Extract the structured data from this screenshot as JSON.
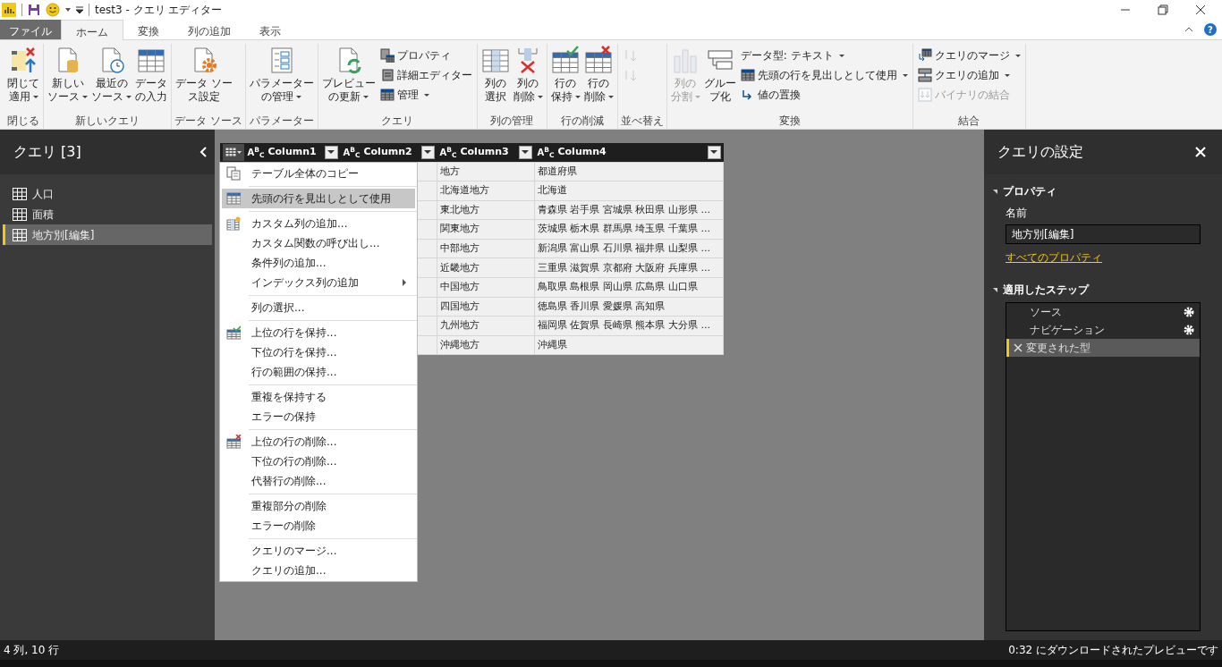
{
  "window": {
    "title": "test3 - クエリ エディター"
  },
  "ribbon_tabs": [
    {
      "label": "ファイル",
      "kind": "file",
      "selected": false
    },
    {
      "label": "ホーム",
      "kind": "tab",
      "selected": true
    },
    {
      "label": "変換",
      "kind": "tab",
      "selected": false
    },
    {
      "label": "列の追加",
      "kind": "tab",
      "selected": false
    },
    {
      "label": "表示",
      "kind": "tab",
      "selected": false
    }
  ],
  "help": "?",
  "ribbon_groups": [
    {
      "label": "閉じる",
      "large": [
        {
          "lines": [
            "閉じて",
            "適用"
          ],
          "kind": "apply",
          "dropdown": true,
          "disabled": false
        }
      ]
    },
    {
      "label": "新しいクエリ",
      "large": [
        {
          "lines": [
            "新しい",
            "ソース"
          ],
          "kind": "new",
          "dropdown": true,
          "disabled": false
        },
        {
          "lines": [
            "最近の",
            "ソース"
          ],
          "kind": "recent",
          "dropdown": true,
          "disabled": false
        },
        {
          "lines": [
            "データ",
            "の入力"
          ],
          "kind": "table",
          "dropdown": false,
          "disabled": false
        }
      ]
    },
    {
      "label": "データ ソース",
      "large": [
        {
          "lines": [
            "データ ソー",
            "ス設定"
          ],
          "kind": "dsettings",
          "dropdown": false,
          "disabled": false
        }
      ]
    },
    {
      "label": "パラメーター",
      "large": [
        {
          "lines": [
            "パラメーター",
            "の管理"
          ],
          "kind": "params",
          "dropdown": true,
          "disabled": false
        }
      ]
    },
    {
      "label": "クエリ",
      "large": [
        {
          "lines": [
            "プレビュー",
            "の更新"
          ],
          "kind": "refresh",
          "dropdown": true,
          "disabled": false
        }
      ],
      "small": [
        {
          "label": "プロパティ",
          "kind": "props",
          "dropdown": false,
          "disabled": false
        },
        {
          "label": "詳細エディター",
          "kind": "editor",
          "dropdown": false,
          "disabled": false
        },
        {
          "label": "管理",
          "kind": "grid",
          "dropdown": true,
          "disabled": false
        }
      ]
    },
    {
      "label": "列の管理",
      "large": [
        {
          "lines": [
            "列の",
            "選択"
          ],
          "kind": "choosecols",
          "dropdown": false,
          "disabled": false
        },
        {
          "lines": [
            "列の",
            "削除"
          ],
          "kind": "removecols",
          "dropdown": true,
          "disabled": false
        }
      ]
    },
    {
      "label": "行の削減",
      "large": [
        {
          "lines": [
            "行の",
            "保持"
          ],
          "kind": "keeprows",
          "dropdown": true,
          "disabled": false
        },
        {
          "lines": [
            "行の",
            "削除"
          ],
          "kind": "removerows",
          "dropdown": true,
          "disabled": false
        }
      ]
    },
    {
      "label": "並べ替え",
      "small": [
        {
          "kind": "sortasc",
          "dropdown": false,
          "disabled": true
        },
        {
          "kind": "sortdesc",
          "dropdown": false,
          "disabled": true
        }
      ]
    },
    {
      "label": "変換",
      "large": [
        {
          "lines": [
            "列の",
            "分割"
          ],
          "kind": "split",
          "dropdown": true,
          "disabled": true
        },
        {
          "lines": [
            "グルー",
            "プ化"
          ],
          "kind": "group",
          "dropdown": false,
          "disabled": false
        }
      ],
      "small": [
        {
          "label": "データ型: テキスト",
          "kind": "none",
          "dropdown": true,
          "disabled": false
        },
        {
          "label": "先頭の行を見出しとして使用",
          "kind": "grid",
          "dropdown": true,
          "disabled": false
        },
        {
          "label": "値の置換",
          "kind": "replace",
          "dropdown": false,
          "disabled": false
        }
      ]
    },
    {
      "label": "結合",
      "small": [
        {
          "label": "クエリのマージ",
          "kind": "merge",
          "dropdown": true,
          "disabled": false
        },
        {
          "label": "クエリの追加",
          "kind": "append",
          "dropdown": true,
          "disabled": false
        },
        {
          "label": "バイナリの結合",
          "kind": "binary",
          "dropdown": false,
          "disabled": true
        }
      ]
    }
  ],
  "queries_pane": {
    "title": "クエリ [3]",
    "items": [
      {
        "label": "人口",
        "selected": false
      },
      {
        "label": "面積",
        "selected": false
      },
      {
        "label": "地方別[編集]",
        "selected": true
      }
    ]
  },
  "table": {
    "columns": [
      {
        "type": "A$^{B}$$_{C}$",
        "name": "Column1"
      },
      {
        "type": "A$^{B}$$_{C}$",
        "name": "Column2"
      },
      {
        "type": "A$^{B}$$_{C}$",
        "name": "Column3"
      },
      {
        "type": "A$^{B}$$_{C}$",
        "name": "Column4"
      }
    ],
    "rows": [
      {
        "column3": "地方",
        "column4": "都道府県"
      },
      {
        "column3": "北海道地方",
        "column4": "北海道"
      },
      {
        "column3": "東北地方",
        "column4": "青森県 岩手県 宮城県 秋田県 山形県 ..."
      },
      {
        "column3": "関東地方",
        "column4": "茨城県 栃木県 群馬県 埼玉県 千葉県 ..."
      },
      {
        "column3": "中部地方",
        "column4": "新潟県 富山県 石川県 福井県 山梨県 ..."
      },
      {
        "column3": "近畿地方",
        "column4": "三重県 滋賀県 京都府 大阪府 兵庫県 ..."
      },
      {
        "column3": "中国地方",
        "column4": "鳥取県 島根県 岡山県 広島県 山口県"
      },
      {
        "column3": "四国地方",
        "column4": "徳島県 香川県 愛媛県 高知県"
      },
      {
        "column3": "九州地方",
        "column4": "福岡県 佐賀県 長崎県 熊本県 大分県 ..."
      },
      {
        "column3": "沖縄地方",
        "column4": "沖縄県"
      }
    ]
  },
  "table_menu": {
    "groups": [
      [
        {
          "label": "テーブル全体のコピー",
          "kind": "copy",
          "selected": false,
          "submenu": false
        }
      ],
      [
        {
          "label": "先頭の行を見出しとして使用",
          "kind": "header",
          "selected": true,
          "submenu": false
        }
      ],
      [
        {
          "label": "カスタム列の追加...",
          "kind": "custom",
          "selected": false,
          "submenu": false
        },
        {
          "label": "カスタム関数の呼び出し...",
          "kind": "plain",
          "selected": false,
          "submenu": false
        },
        {
          "label": "条件列の追加...",
          "kind": "plain",
          "selected": false,
          "submenu": false
        },
        {
          "label": "インデックス列の追加",
          "kind": "plain",
          "selected": false,
          "submenu": true
        }
      ],
      [
        {
          "label": "列の選択...",
          "kind": "plain",
          "selected": false,
          "submenu": false
        }
      ],
      [
        {
          "label": "上位の行を保持...",
          "kind": "keep",
          "selected": false,
          "submenu": false
        },
        {
          "label": "下位の行を保持...",
          "kind": "plain",
          "selected": false,
          "submenu": false
        },
        {
          "label": "行の範囲の保持...",
          "kind": "plain",
          "selected": false,
          "submenu": false
        }
      ],
      [
        {
          "label": "重複を保持する",
          "kind": "plain",
          "selected": false,
          "submenu": false
        },
        {
          "label": "エラーの保持",
          "kind": "plain",
          "selected": false,
          "submenu": false
        }
      ],
      [
        {
          "label": "上位の行の削除...",
          "kind": "remove",
          "selected": false,
          "submenu": false
        },
        {
          "label": "下位の行の削除...",
          "kind": "plain",
          "selected": false,
          "submenu": false
        },
        {
          "label": "代替行の削除...",
          "kind": "plain",
          "selected": false,
          "submenu": false
        }
      ],
      [
        {
          "label": "重複部分の削除",
          "kind": "plain",
          "selected": false,
          "submenu": false
        },
        {
          "label": "エラーの削除",
          "kind": "plain",
          "selected": false,
          "submenu": false
        }
      ],
      [
        {
          "label": "クエリのマージ...",
          "kind": "plain",
          "selected": false,
          "submenu": false
        },
        {
          "label": "クエリの追加...",
          "kind": "plain",
          "selected": false,
          "submenu": false
        }
      ]
    ]
  },
  "settings_pane": {
    "title": "クエリの設定",
    "properties_heading": "プロパティ",
    "name_label": "名前",
    "name_value": "地方別[編集]",
    "all_properties_link": "すべてのプロパティ",
    "steps_heading": "適用したステップ",
    "steps": [
      {
        "label": "ソース",
        "gear": true,
        "selected": false
      },
      {
        "label": "ナビゲーション",
        "gear": true,
        "selected": false
      },
      {
        "label": "変更された型",
        "gear": false,
        "selected": true
      }
    ]
  },
  "status_bar": {
    "left": "4 列, 10 行",
    "right": "0:32 にダウンロードされたプレビューです"
  }
}
